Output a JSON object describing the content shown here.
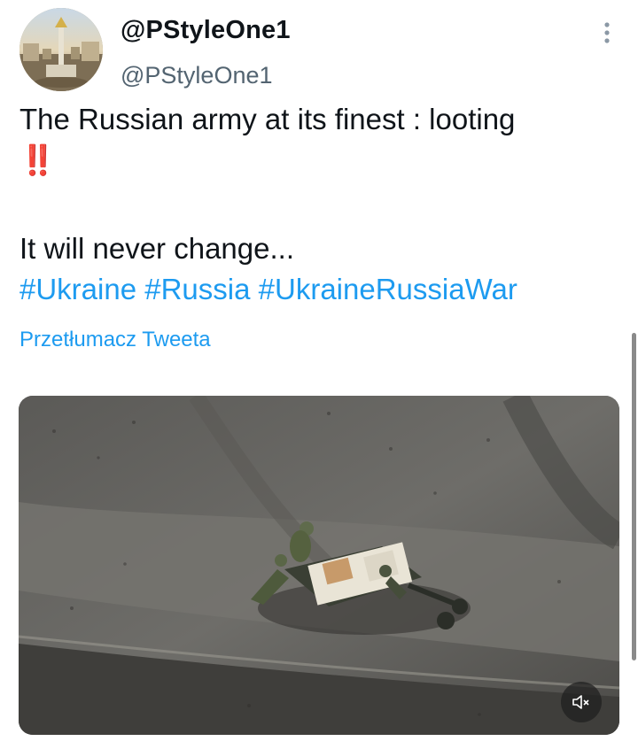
{
  "author": {
    "display_name": "@PStyleOne1",
    "handle": "@PStyleOne1",
    "avatar_icon": "city-monument-avatar"
  },
  "tweet": {
    "line1": "The Russian army at its finest : looting",
    "line2_emoji": "‼️",
    "line3": "It will never change...",
    "hashtags": [
      "#Ukraine",
      "#Russia",
      "#UkraineRussiaWar"
    ],
    "translate_label": "Przetłumacz Tweeta"
  },
  "media": {
    "type": "video",
    "mute_icon": "speaker-muted-icon"
  },
  "colors": {
    "link": "#1d9bf0",
    "text": "#0f1419",
    "secondary": "#536471",
    "emoji_red": "#e0245e"
  }
}
